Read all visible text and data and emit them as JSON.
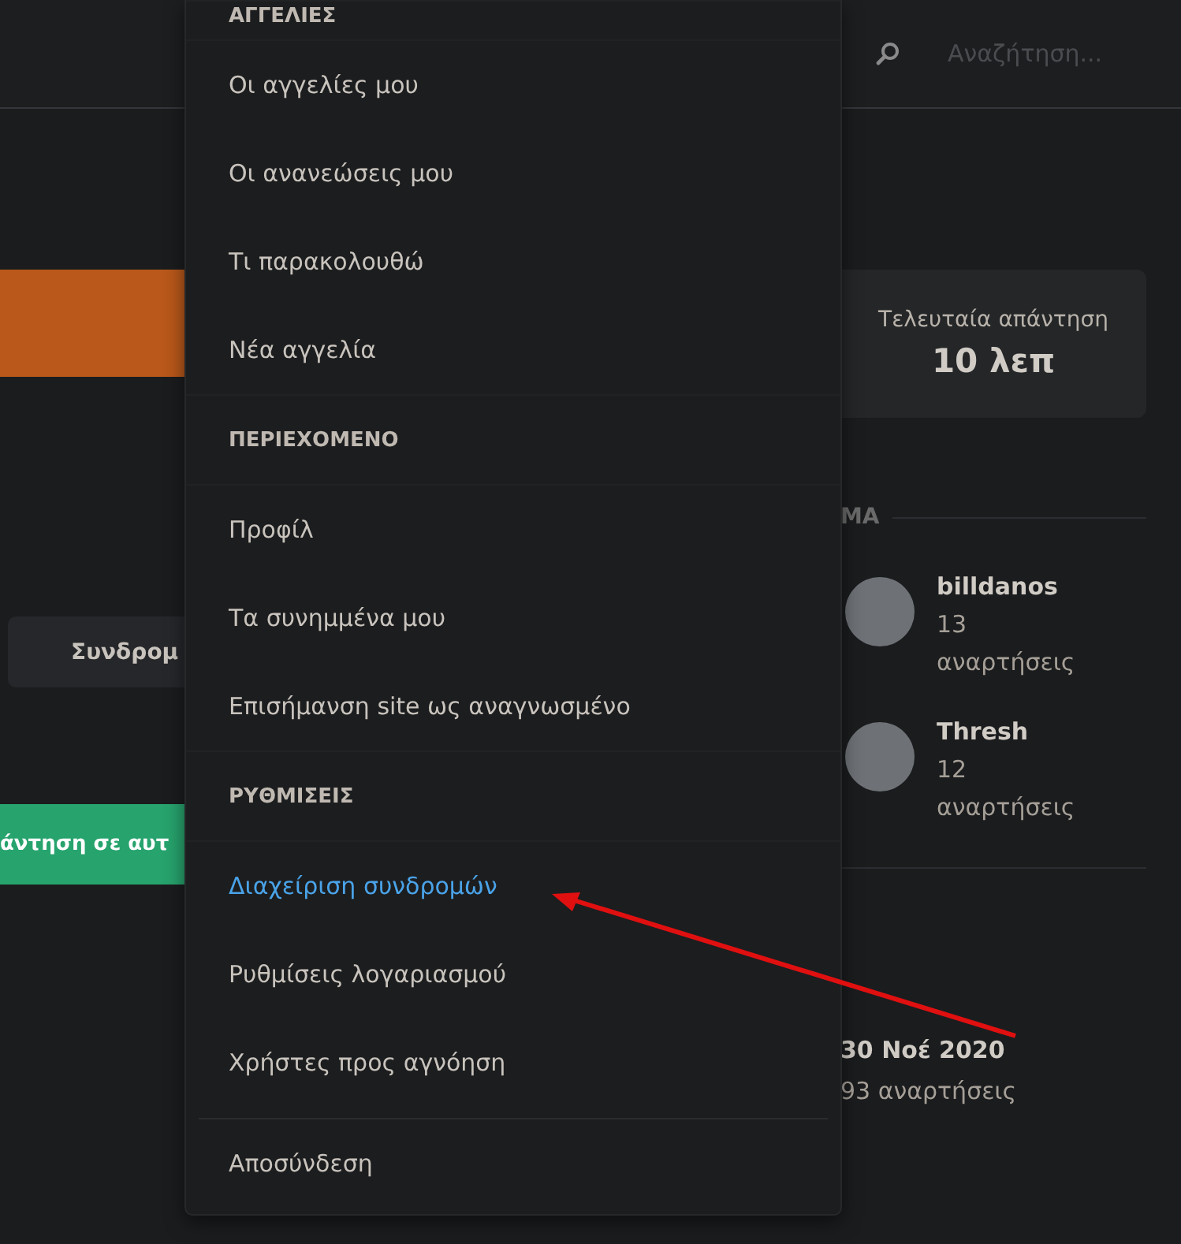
{
  "header": {
    "search_placeholder": "Αναζήτηση..."
  },
  "left_column": {
    "subscribe_button": "Συνδρομ",
    "reply_button": "άντηση σε αυτ"
  },
  "stats_card": {
    "label": "Τελευταία απάντηση",
    "value": "10 λεπ"
  },
  "participants": {
    "heading": "ΜΑ",
    "users": [
      {
        "name": "billdanos",
        "posts": "13 αναρτήσεις"
      },
      {
        "name": "Thresh",
        "posts": "12 αναρτήσεις"
      }
    ]
  },
  "latest": {
    "date": "30 Νοέ 2020",
    "posts": "93 αναρτήσεις"
  },
  "user_menu": {
    "sections": [
      {
        "heading": "ΑΓΓΕΛΙΕΣ",
        "items": [
          {
            "label": "Οι αγγελίες μου",
            "selected": false
          },
          {
            "label": "Οι ανανεώσεις μου",
            "selected": false
          },
          {
            "label": "Τι παρακολουθώ",
            "selected": false
          },
          {
            "label": "Νέα αγγελία",
            "selected": false
          }
        ]
      },
      {
        "heading": "ΠΕΡΙΕΧΟΜΕΝΟ",
        "items": [
          {
            "label": "Προφίλ",
            "selected": false
          },
          {
            "label": "Τα συνημμένα μου",
            "selected": false
          },
          {
            "label": "Επισήμανση site ως αναγνωσμένο",
            "selected": false
          }
        ]
      },
      {
        "heading": "ΡΥΘΜΙΣΕΙΣ",
        "items": [
          {
            "label": "Διαχείριση συνδρομών",
            "selected": true
          },
          {
            "label": "Ρυθμίσεις λογαριασμού",
            "selected": false
          },
          {
            "label": "Χρήστες προς αγνόηση",
            "selected": false
          }
        ]
      }
    ],
    "logout": "Αποσύνδεση"
  }
}
